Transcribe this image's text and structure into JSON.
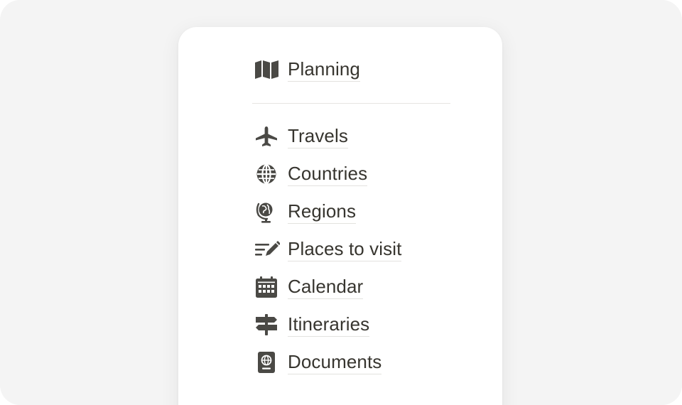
{
  "header_item": {
    "label": "Planning",
    "icon": "map-icon"
  },
  "items": [
    {
      "label": "Travels",
      "icon": "airplane-icon"
    },
    {
      "label": "Countries",
      "icon": "globe-icon"
    },
    {
      "label": "Regions",
      "icon": "desk-globe-icon"
    },
    {
      "label": "Places to visit",
      "icon": "list-pencil-icon"
    },
    {
      "label": "Calendar",
      "icon": "calendar-icon"
    },
    {
      "label": "Itineraries",
      "icon": "signpost-icon"
    },
    {
      "label": "Documents",
      "icon": "passport-icon"
    }
  ],
  "colors": {
    "text": "#37352f",
    "icon": "#4a4945",
    "underline": "#e3e2df",
    "background": "#f4f4f4",
    "card": "#ffffff"
  }
}
